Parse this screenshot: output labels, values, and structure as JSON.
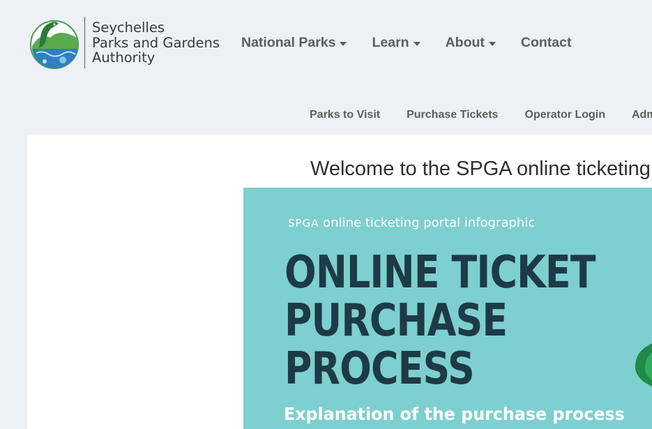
{
  "header": {
    "logo_lines": [
      "Seychelles",
      "Parks and Gardens",
      "Authority"
    ]
  },
  "main_nav": [
    {
      "label": "National Parks",
      "dropdown": true
    },
    {
      "label": "Learn",
      "dropdown": true
    },
    {
      "label": "About",
      "dropdown": true
    },
    {
      "label": "Contact",
      "dropdown": false
    }
  ],
  "sub_nav": [
    "Parks to Visit",
    "Purchase Tickets",
    "Operator Login",
    "Adm"
  ],
  "content": {
    "welcome": "Welcome to the SPGA online ticketing",
    "infographic": {
      "subtitle_abbr": "SPGA",
      "subtitle_rest": " online ticketing portal infographic",
      "title_lines": [
        "ONLINE TICKET",
        "PURCHASE",
        "PROCESS"
      ],
      "explanation": "Explanation of the purchase process"
    }
  },
  "colors": {
    "background": "#edf0f5",
    "nav_text": "#5d5d5d",
    "infographic_bg": "#7ecfcf",
    "infographic_title": "#1d3a48"
  }
}
